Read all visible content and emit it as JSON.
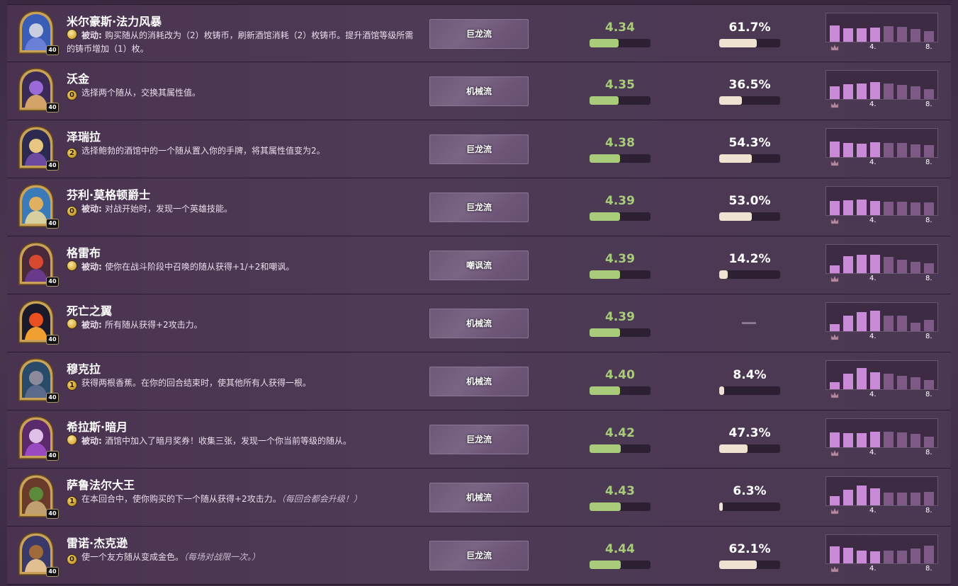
{
  "columns": {
    "axis_tick_mid": "4.",
    "axis_tick_end": "8.",
    "no_data": "—"
  },
  "colors": {
    "rating_green": "#a8cc7a",
    "pick_cream": "#f0e2d0",
    "bar_light": "#c98ad8",
    "bar_dark": "#7d5a85"
  },
  "heroes": [
    {
      "name": "米尔豪斯·法力风暴",
      "cost": "",
      "cost_kind": "gold",
      "power_kw": "被动: ",
      "power": "购买随从的消耗改为（2）枚铸币，刷新酒馆消耗（2）枚铸币。提升酒馆等级所需的铸币增加（1）枚。",
      "power_hint": "",
      "armor": "40",
      "tribe": "巨龙流",
      "rating": "4.34",
      "rating_pct": 48,
      "pick": "61.7%",
      "pick_pct": 62,
      "dist": [
        0.58,
        0.48,
        0.48,
        0.5,
        0.54,
        0.52,
        0.46,
        0.38
      ],
      "palette": [
        "#3a5db8",
        "#c8cde0",
        "#6a7fd6"
      ]
    },
    {
      "name": "沃金",
      "cost": "0",
      "cost_kind": "num",
      "power_kw": "",
      "power": "选择两个随从，交换其属性值。",
      "power_hint": "",
      "armor": "40",
      "tribe": "机械流",
      "rating": "4.35",
      "rating_pct": 48,
      "pick": "36.5%",
      "pick_pct": 37,
      "dist": [
        0.46,
        0.52,
        0.56,
        0.6,
        0.54,
        0.5,
        0.46,
        0.36
      ],
      "palette": [
        "#3b2a55",
        "#9a6ad8",
        "#d4a36a"
      ]
    },
    {
      "name": "泽瑞拉",
      "cost": "2",
      "cost_kind": "num",
      "power_kw": "",
      "power": "选择鲍勃的酒馆中的一个随从置入你的手牌，将其属性值变为2。",
      "power_hint": "",
      "armor": "40",
      "tribe": "巨龙流",
      "rating": "4.38",
      "rating_pct": 50,
      "pick": "54.3%",
      "pick_pct": 54,
      "dist": [
        0.56,
        0.5,
        0.48,
        0.52,
        0.5,
        0.5,
        0.46,
        0.42
      ],
      "palette": [
        "#2c2a50",
        "#e6c680",
        "#6c4aa0"
      ]
    },
    {
      "name": "芬利·莫格顿爵士",
      "cost": "0",
      "cost_kind": "num",
      "power_kw": "被动: ",
      "power": "对战开始时，发现一个英雄技能。",
      "power_hint": "",
      "armor": "40",
      "tribe": "巨龙流",
      "rating": "4.39",
      "rating_pct": 50,
      "pick": "53.0%",
      "pick_pct": 53,
      "dist": [
        0.5,
        0.52,
        0.54,
        0.5,
        0.48,
        0.48,
        0.46,
        0.46
      ],
      "palette": [
        "#3a7ab8",
        "#e0b060",
        "#d8cfa0"
      ]
    },
    {
      "name": "格雷布",
      "cost": "",
      "cost_kind": "gold",
      "power_kw": "被动: ",
      "power": "使你在战斗阶段中召唤的随从获得+1/+2和嘲讽。",
      "power_hint": "",
      "armor": "40",
      "tribe": "嘲讽流",
      "rating": "4.39",
      "rating_pct": 50,
      "pick": "14.2%",
      "pick_pct": 14,
      "dist": [
        0.28,
        0.6,
        0.64,
        0.64,
        0.58,
        0.48,
        0.4,
        0.36
      ],
      "palette": [
        "#4a2a3a",
        "#d84a30",
        "#6a3a8a"
      ]
    },
    {
      "name": "死亡之翼",
      "cost": "",
      "cost_kind": "gold",
      "power_kw": "被动: ",
      "power": "所有随从获得+2攻击力。",
      "power_hint": "",
      "armor": "40",
      "tribe": "机械流",
      "rating": "4.39",
      "rating_pct": 50,
      "pick": "",
      "pick_pct": null,
      "dist": [
        0.26,
        0.56,
        0.68,
        0.72,
        0.56,
        0.54,
        0.3,
        0.4
      ],
      "palette": [
        "#1a1a2a",
        "#e85020",
        "#f0a030"
      ]
    },
    {
      "name": "穆克拉",
      "cost": "1",
      "cost_kind": "num",
      "power_kw": "",
      "power": "获得两根香蕉。在你的回合结束时，使其他所有人获得一根。",
      "power_hint": "",
      "armor": "40",
      "tribe": "机械流",
      "rating": "4.40",
      "rating_pct": 50,
      "pick": "8.4%",
      "pick_pct": 8,
      "dist": [
        0.26,
        0.56,
        0.76,
        0.6,
        0.54,
        0.48,
        0.42,
        0.32
      ],
      "palette": [
        "#2a4a6a",
        "#8a8a9a",
        "#5a6a8a"
      ]
    },
    {
      "name": "希拉斯·暗月",
      "cost": "",
      "cost_kind": "gold",
      "power_kw": "被动: ",
      "power": "酒馆中加入了暗月奖券！收集三张，发现一个你当前等级的随从。",
      "power_hint": "",
      "armor": "40",
      "tribe": "巨龙流",
      "rating": "4.42",
      "rating_pct": 51,
      "pick": "47.3%",
      "pick_pct": 47,
      "dist": [
        0.52,
        0.5,
        0.5,
        0.54,
        0.56,
        0.52,
        0.48,
        0.38
      ],
      "palette": [
        "#5a2a6a",
        "#e0c0e8",
        "#9a4ac0"
      ]
    },
    {
      "name": "萨鲁法尔大王",
      "cost": "1",
      "cost_kind": "num",
      "power_kw": "",
      "power": "在本回合中，使你购买的下一个随从获得+2攻击力。",
      "power_hint": "（每回合都会升级！）",
      "armor": "40",
      "tribe": "机械流",
      "rating": "4.43",
      "rating_pct": 51,
      "pick": "6.3%",
      "pick_pct": 6,
      "dist": [
        0.32,
        0.56,
        0.7,
        0.6,
        0.46,
        0.44,
        0.44,
        0.48
      ],
      "palette": [
        "#6a3a2a",
        "#5a8a3a",
        "#c0a070"
      ]
    },
    {
      "name": "雷诺·杰克逊",
      "cost": "0",
      "cost_kind": "num",
      "power_kw": "",
      "power": "使一个友方随从变成金色。",
      "power_hint": "（每场对战限一次。）",
      "armor": "40",
      "tribe": "巨龙流",
      "rating": "4.44",
      "rating_pct": 51,
      "pick": "62.1%",
      "pick_pct": 62,
      "dist": [
        0.6,
        0.54,
        0.46,
        0.42,
        0.46,
        0.46,
        0.52,
        0.62
      ],
      "palette": [
        "#3a3a6a",
        "#a06a3a",
        "#e0c090"
      ]
    }
  ]
}
